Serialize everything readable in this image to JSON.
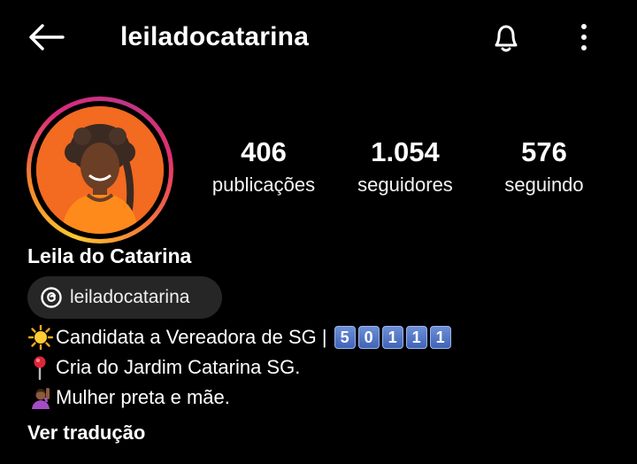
{
  "header": {
    "back_icon": "arrow-left-icon",
    "username": "leiladocatarina",
    "bell_icon": "bell-icon",
    "more_icon": "more-vertical-icon"
  },
  "profile": {
    "avatar_icon": "profile-photo",
    "ring_colors": [
      "#fdc830",
      "#f58529",
      "#dd2a7b",
      "#c13584"
    ],
    "stats": [
      {
        "value": "406",
        "label": "publicações"
      },
      {
        "value": "1.054",
        "label": "seguidores"
      },
      {
        "value": "576",
        "label": "seguindo"
      }
    ],
    "display_name": "Leila do Catarina",
    "threads": {
      "icon": "threads-icon",
      "handle": "leiladocatarina"
    },
    "bio": [
      {
        "emoji": "sun-icon",
        "text": "Candidata a Vereadora de SG |",
        "keycaps": [
          "5",
          "0",
          "1",
          "1",
          "1"
        ]
      },
      {
        "emoji": "pin-icon",
        "text": "Cria do Jardim Catarina SG."
      },
      {
        "emoji": "raising-hand-icon",
        "text": "Mulher preta e mãe."
      }
    ],
    "translate": "Ver tradução"
  }
}
